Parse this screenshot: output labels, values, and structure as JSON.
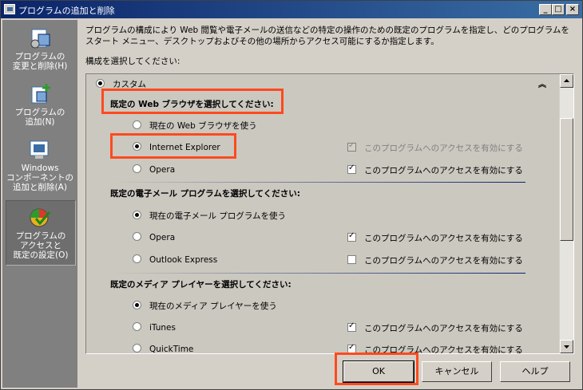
{
  "window": {
    "title": "プログラムの追加と削除"
  },
  "sidebar": {
    "items": [
      {
        "label": "プログラムの\n変更と削除(H)",
        "icon": "change-remove-programs-icon"
      },
      {
        "label": "プログラムの\n追加(N)",
        "icon": "add-programs-icon"
      },
      {
        "label": "Windows\nコンポーネントの\n追加と削除(A)",
        "icon": "windows-components-icon"
      },
      {
        "label": "プログラムの\nアクセスと\n既定の設定(O)",
        "icon": "program-access-defaults-icon",
        "active": true
      }
    ]
  },
  "content": {
    "description": "プログラムの構成により Web 閲覧や電子メールの送信などの特定の操作のための既定のプログラムを指定し、どのプログラムをスタート メニュー、デスクトップおよびその他の場所からアクセス可能にするか指定します。",
    "select_label": "構成を選択してください:",
    "config_name": "カスタム",
    "enable_access_label": "このプログラムへのアクセスを有効にする",
    "sections": [
      {
        "title": "既定の Web ブラウザを選択してください:",
        "options": [
          {
            "label": "現在の Web ブラウザを使う",
            "selected": false
          },
          {
            "label": "Internet Explorer",
            "selected": true,
            "access": true,
            "access_disabled": true
          },
          {
            "label": "Opera",
            "selected": false,
            "access": true
          }
        ]
      },
      {
        "title": "既定の電子メール プログラムを選択してください:",
        "options": [
          {
            "label": "現在の電子メール プログラムを使う",
            "selected": true
          },
          {
            "label": "Opera",
            "selected": false,
            "access": true
          },
          {
            "label": "Outlook Express",
            "selected": false,
            "access": false
          }
        ]
      },
      {
        "title": "既定のメディア プレイヤーを選択してください:",
        "options": [
          {
            "label": "現在のメディア プレイヤーを使う",
            "selected": true
          },
          {
            "label": "iTunes",
            "selected": false,
            "access": true
          },
          {
            "label": "QuickTime",
            "selected": false,
            "access": true
          }
        ]
      }
    ]
  },
  "buttons": {
    "ok": "OK",
    "cancel": "キャンセル",
    "help": "ヘルプ"
  },
  "colors": {
    "title_bar": "#0a246a",
    "highlight": "#ff4a1e",
    "sidebar": "#808080"
  }
}
